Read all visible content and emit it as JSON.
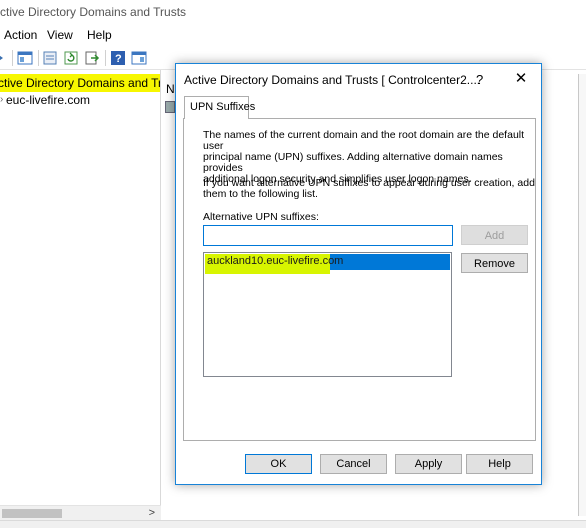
{
  "window": {
    "title": "ctive Directory Domains and Trusts"
  },
  "menu": {
    "items": [
      "Action",
      "View",
      "Help"
    ]
  },
  "tree": {
    "root": "ctive Directory Domains and Trust",
    "child": "euc-livefire.com",
    "scroll_arrow": ">"
  },
  "rightpane": {
    "header_letter": "N"
  },
  "dialog": {
    "title": "Active Directory Domains and Trusts [ Controlcenter2....",
    "help_glyph": "?",
    "close_glyph": "✕",
    "tab": "UPN Suffixes",
    "desc1": [
      "The names of the current domain and the root domain are the default user",
      "principal name (UPN) suffixes. Adding alternative domain names provides",
      "additional logon security and simplifies user logon names."
    ],
    "desc2": [
      "If you want alternative UPN suffixes to appear during user creation, add",
      "them to the following list."
    ],
    "alt_label": "Alternative UPN suffixes:",
    "input_value": "",
    "add_button": "Add",
    "remove_button": "Remove",
    "list_items": [
      "auckland10.euc-livefire.com"
    ],
    "ok_button": "OK",
    "cancel_button": "Cancel",
    "apply_button": "Apply",
    "help_button": "Help"
  },
  "colors": {
    "highlight": "#f7f700",
    "selection": "#0078d7",
    "dialog_border": "#1883d7"
  }
}
